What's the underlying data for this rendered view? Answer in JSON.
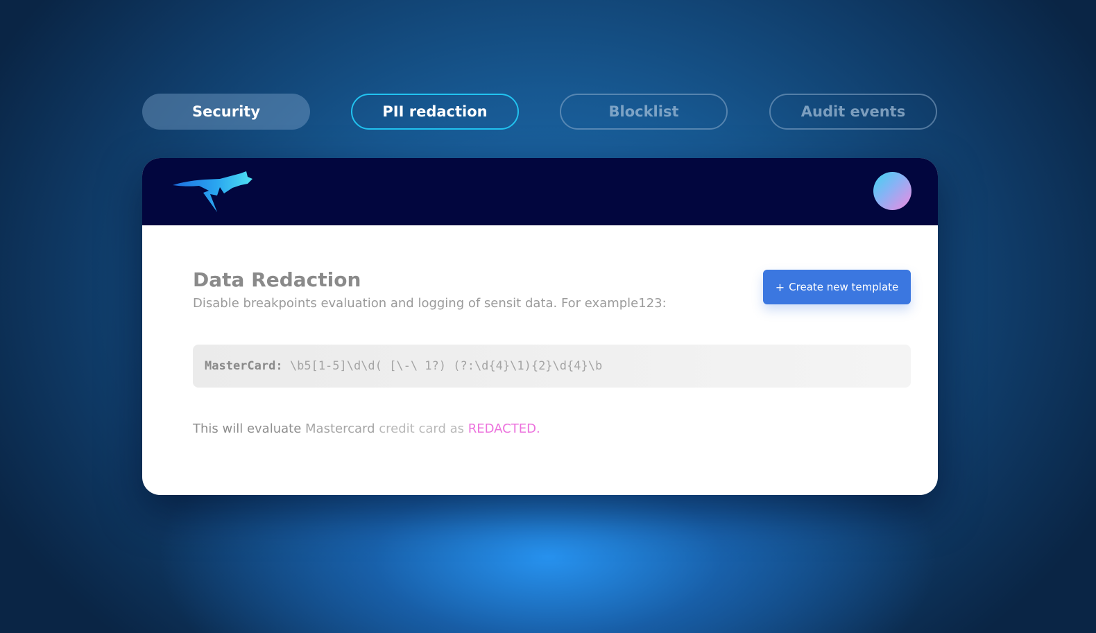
{
  "tabs": [
    {
      "label": "Security",
      "state": "selected"
    },
    {
      "label": "PII redaction",
      "state": "focused"
    },
    {
      "label": "Blocklist",
      "state": "inactive"
    },
    {
      "label": "Audit events",
      "state": "inactive"
    }
  ],
  "header": {
    "logo_icon": "cheetah-lightning-logo-icon",
    "avatar_icon": "gradient-avatar-circle"
  },
  "main": {
    "title": "Data Redaction",
    "subtitle": "Disable breakpoints evaluation and logging of sensit data. For example123:",
    "create_button": {
      "plus": "+",
      "label": "Create new template"
    },
    "code": {
      "label": "MasterCard:",
      "pattern": "\\b5[1-5]\\d\\d( [\\-\\ 1?) (?:\\d{4}\\1){2}\\d{4}\\b"
    },
    "note": {
      "part1": "This will evaluate",
      "part2": "Mastercard",
      "part3": "credit card as",
      "highlight": "REDACTED."
    }
  },
  "colors": {
    "accent": "#3b77e0",
    "tab_focus": "#22c3f0",
    "header_bg": "#02063e",
    "highlight": "#ec72dd"
  }
}
